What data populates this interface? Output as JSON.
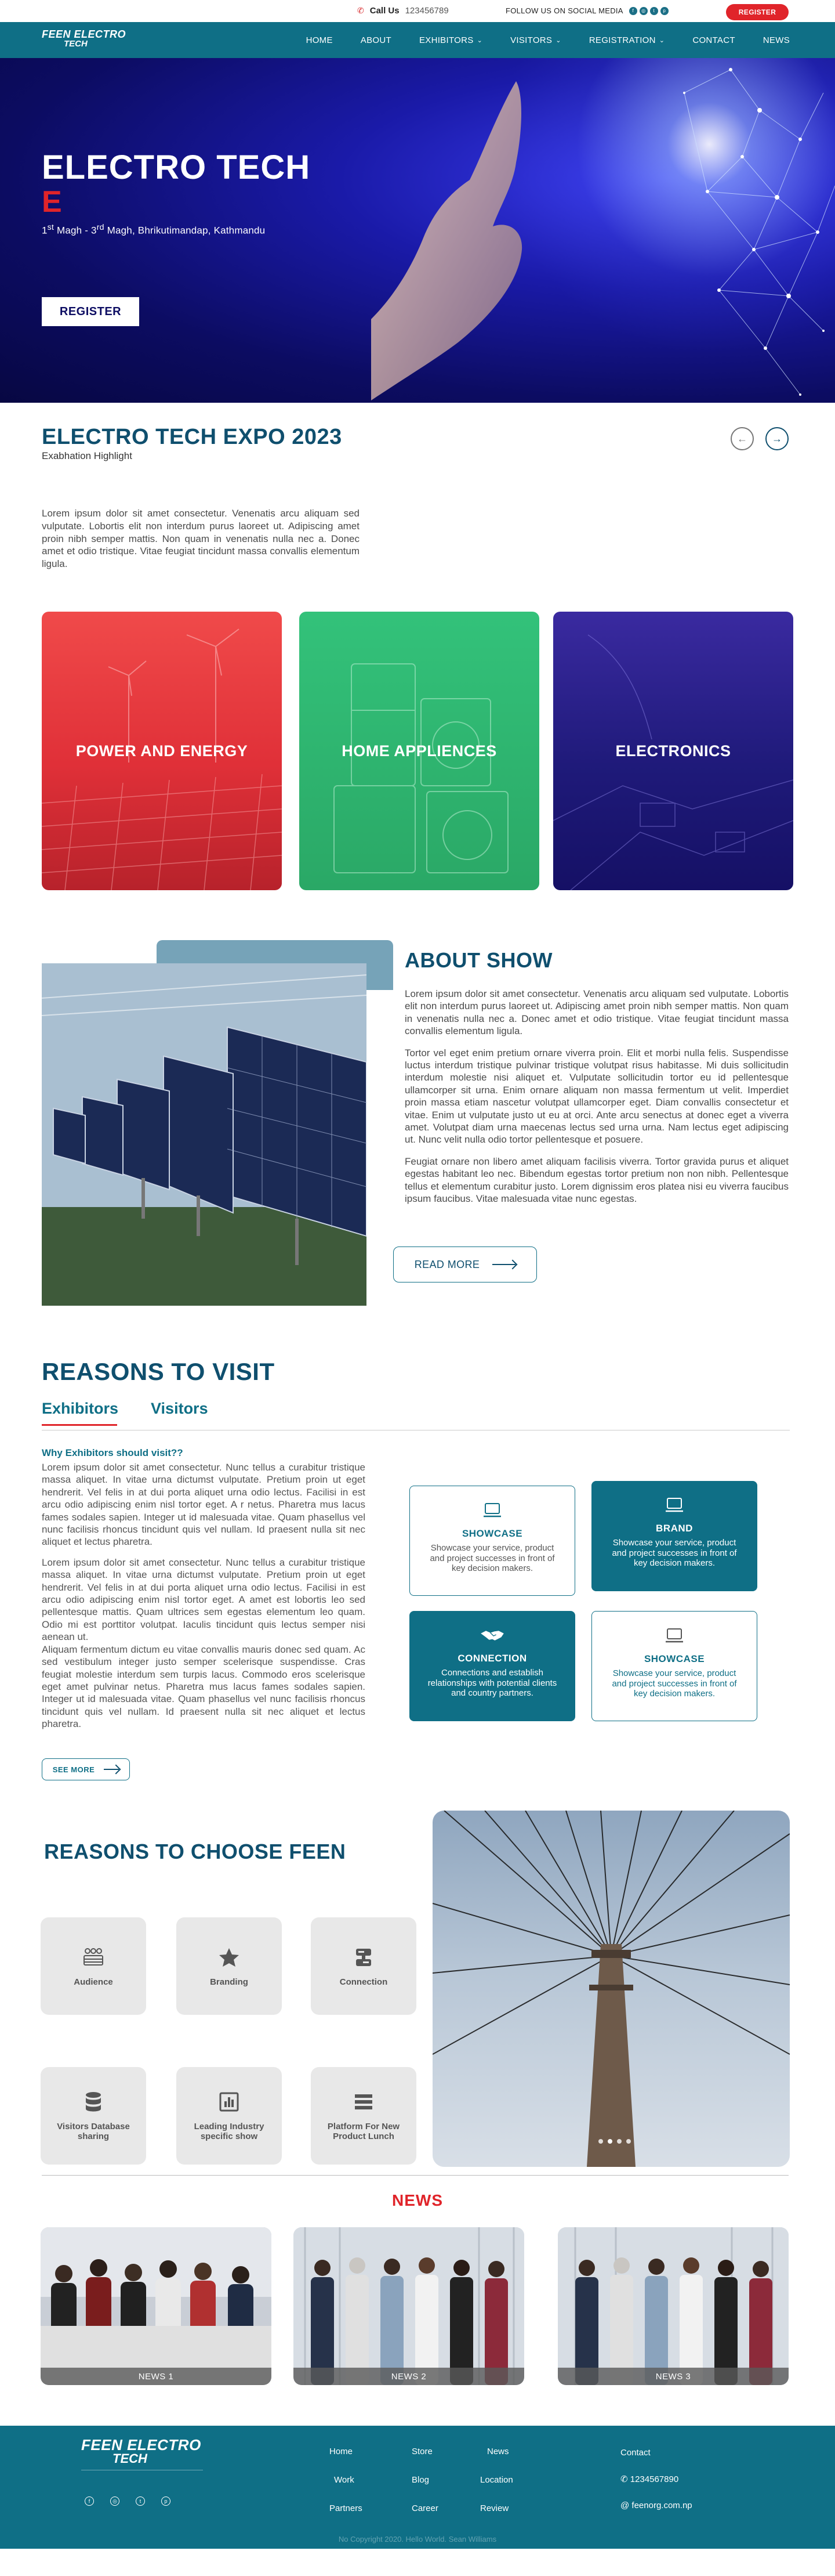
{
  "topbar": {
    "call_label": "Call Us",
    "phone": "123456789",
    "social_label": "FOLLOW US ON SOCIAL MEDIA",
    "register": "REGISTER"
  },
  "brand": {
    "line1": "FEEN ELECTRO",
    "line2": "TECH"
  },
  "nav": [
    {
      "label": "HOME",
      "dropdown": false
    },
    {
      "label": "ABOUT",
      "dropdown": false
    },
    {
      "label": "EXHIBITORS",
      "dropdown": true
    },
    {
      "label": "VISITORS",
      "dropdown": true
    },
    {
      "label": "REGISTRATION",
      "dropdown": true
    },
    {
      "label": "CONTACT",
      "dropdown": false
    },
    {
      "label": "NEWS",
      "dropdown": false
    }
  ],
  "hero": {
    "title": "ELECTRO TECH",
    "caret": "E",
    "date_1": "1",
    "date_1_sup": "st",
    "date_1_month": " Magh - ",
    "date_2": "3",
    "date_2_sup": "rd",
    "date_2_rest": " Magh,  Bhrikutimandap, Kathmandu",
    "register": "REGISTER"
  },
  "expo": {
    "title": "ELECTRO TECH  EXPO 2023",
    "subtitle": "Exabhation Highlight",
    "body": "Lorem ipsum dolor sit amet consectetur. Venenatis arcu aliquam sed vulputate. Lobortis elit non interdum purus laoreet ut. Adipiscing amet proin nibh semper mattis. Non quam in venenatis nulla nec a. Donec amet et odio tristique. Vitae feugiat tincidunt massa convallis elementum ligula."
  },
  "categories": [
    {
      "label": "POWER AND ENERGY"
    },
    {
      "label": "HOME APPLIENCES"
    },
    {
      "label": "ELECTRONICS"
    }
  ],
  "about": {
    "title": "ABOUT SHOW",
    "paragraphs": [
      "Lorem ipsum dolor sit amet consectetur. Venenatis arcu aliquam sed vulputate. Lobortis elit non interdum purus laoreet ut. Adipiscing amet proin nibh semper mattis. Non quam in venenatis nulla nec a. Donec amet et odio tristique. Vitae feugiat tincidunt massa convallis elementum ligula.",
      "Tortor vel eget enim pretium ornare viverra proin. Elit et morbi nulla felis. Suspendisse luctus interdum tristique pulvinar tristique volutpat risus habitasse. Mi duis sollicitudin interdum molestie nisi aliquet et. Vulputate sollicitudin tortor eu id pellentesque ullamcorper sit urna. Enim ornare aliquam non massa fermentum ut velit. Imperdiet proin massa etiam nascetur volutpat ullamcorper eget. Diam convallis consectetur et vitae. Enim ut vulputate justo ut eu at orci. Ante arcu senectus at donec eget a viverra amet. Volutpat diam urna maecenas lectus sed urna urna. Nam lectus eget adipiscing ut. Nunc velit nulla odio tortor pellentesque et posuere.",
      "Feugiat ornare non libero amet aliquam facilisis viverra. Tortor gravida purus et aliquet egestas habitant leo nec. Bibendum egestas tortor pretium non non nibh. Pellentesque tellus et elementum curabitur justo. Lorem dignissim eros platea nisi eu viverra faucibus ipsum faucibus. Vitae malesuada vitae nunc egestas."
    ],
    "read_more": "READ MORE"
  },
  "visit": {
    "title": "REASONS TO VISIT",
    "tab_exhibitors": "Exhibitors",
    "tab_visitors": "Visitors",
    "question": "Why Exhibitors should visit??",
    "paragraphs": [
      "Lorem ipsum dolor sit amet consectetur. Nunc tellus a curabitur tristique massa aliquet. In vitae urna dictumst vulputate. Pretium proin ut eget hendrerit. Vel felis in at dui porta aliquet urna odio lectus. Facilisi in est arcu odio adipiscing enim nisl tortor eget. A r netus. Pharetra mus lacus fames sodales sapien. Integer ut id malesuada vitae. Quam phasellus vel nunc facilisis rhoncus tincidunt quis vel nullam. Id praesent nulla sit nec aliquet et lectus pharetra.",
      "Lorem ipsum dolor sit amet consectetur. Nunc tellus a curabitur tristique massa aliquet. In vitae urna dictumst vulputate. Pretium proin ut eget hendrerit. Vel felis in at dui porta aliquet urna odio lectus. Facilisi in est arcu odio adipiscing enim nisl tortor eget. A amet est lobortis leo sed pellentesque mattis. Quam ultrices sem egestas elementum leo quam. Odio mi est porttitor volutpat. Iaculis tincidunt quis lectus semper nisi aenean ut.\nAliquam fermentum dictum eu vitae convallis mauris donec sed quam. Ac sed vestibulum integer justo semper scelerisque suspendisse. Cras feugiat molestie interdum sem turpis lacus. Commodo eros scelerisque eget amet pulvinar netus. Pharetra mus lacus fames sodales sapien. Integer ut id malesuada vitae. Quam phasellus vel nunc facilisis rhoncus tincidunt quis vel nullam. Id praesent nulla sit nec aliquet et lectus pharetra."
    ],
    "see_more": "SEE MORE",
    "boxes": [
      {
        "title": "SHOWCASE",
        "desc": "Showcase your service, product and project successes in front of key decision makers.",
        "icon": "laptop-icon"
      },
      {
        "title": "BRAND",
        "desc": "Showcase your service, product and project successes in front of key decision makers.",
        "icon": "laptop-icon"
      },
      {
        "title": "CONNECTION",
        "desc": "Connections and establish relationships with potential clients and country partners.",
        "icon": "handshake-icon"
      },
      {
        "title": "SHOWCASE",
        "desc": "Showcase your service, product and project successes in front of key decision makers.",
        "icon": "laptop-icon"
      }
    ]
  },
  "choose": {
    "title": "REASONS TO CHOOSE FEEN",
    "tiles": [
      {
        "label": "Audience",
        "icon": "audience-icon"
      },
      {
        "label": "Branding",
        "icon": "star-icon"
      },
      {
        "label": "Connection",
        "icon": "connection-icon"
      },
      {
        "label": "Visitors Database sharing",
        "icon": "database-icon"
      },
      {
        "label": "Leading Industry specific show",
        "icon": "chart-icon"
      },
      {
        "label": "Platform For New Product Lunch",
        "icon": "list-icon"
      }
    ]
  },
  "news": {
    "title": "NEWS",
    "items": [
      {
        "caption": "NEWS 1"
      },
      {
        "caption": "NEWS 2"
      },
      {
        "caption": "NEWS 3"
      }
    ]
  },
  "footer": {
    "col1": [
      "Home",
      "Work",
      "Partners"
    ],
    "col2": [
      "Store",
      "Blog",
      "Career"
    ],
    "col3": [
      "News",
      "Location",
      "Review"
    ],
    "contact_title": "Contact",
    "phone": "1234567890",
    "email": "feenorg.com.np",
    "copyright": "No Copyright 2020. Hello World. Sean Williams"
  },
  "colors": {
    "primary": "#0f6f86",
    "heading": "#0f4f6e",
    "accent": "#e0242a"
  }
}
